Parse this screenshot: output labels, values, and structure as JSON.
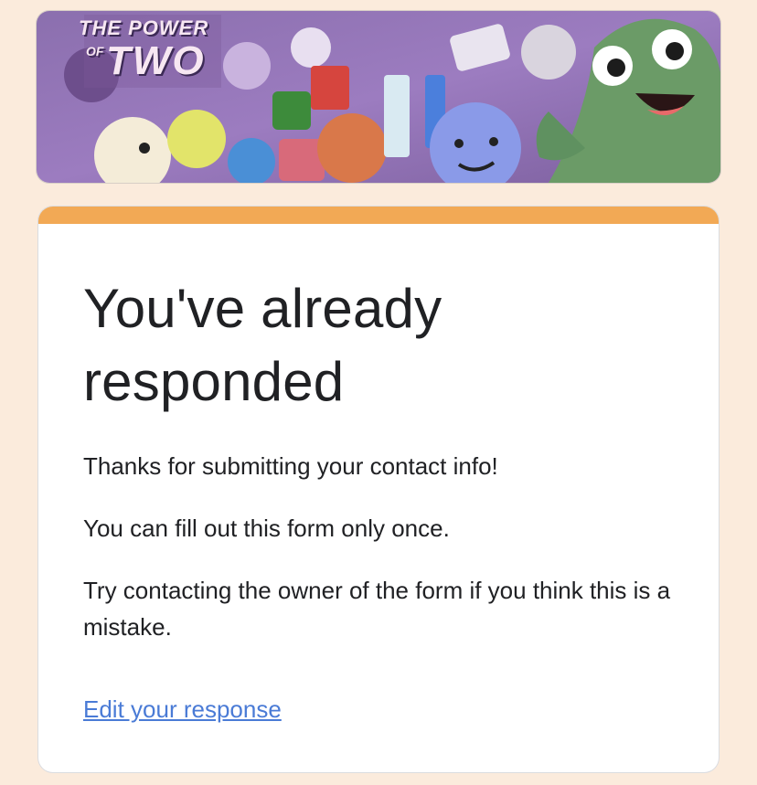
{
  "banner": {
    "logo_line1": "THE POWER",
    "logo_line2": "OF",
    "logo_line3": "TWO"
  },
  "card": {
    "accent_color": "#f2a955",
    "title": "You've already responded",
    "messages": [
      "Thanks for submitting your contact info!",
      "You can fill out this form only once.",
      "Try contacting the owner of the form if you think this is a mistake."
    ],
    "edit_link": "Edit your response",
    "link_color": "#4a7bd6"
  }
}
